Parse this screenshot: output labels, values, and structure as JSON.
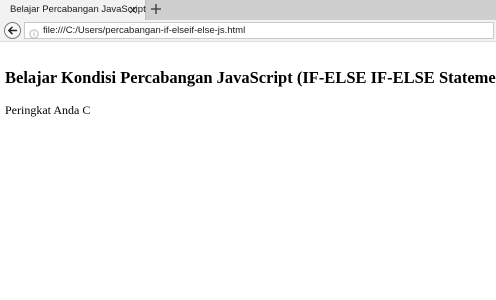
{
  "browser": {
    "tab_title": "Belajar Percabangan JavaScript",
    "address": "file:///C:/Users/percabangan-if-elseif-else-js.html",
    "icons": {
      "close": "close-icon",
      "new_tab": "plus-icon",
      "back": "back-arrow-icon",
      "info": "info-icon"
    }
  },
  "page": {
    "heading": "Belajar Kondisi Percabangan JavaScript (IF-ELSE IF-ELSE Statement)",
    "result": "Peringkat Anda C"
  }
}
